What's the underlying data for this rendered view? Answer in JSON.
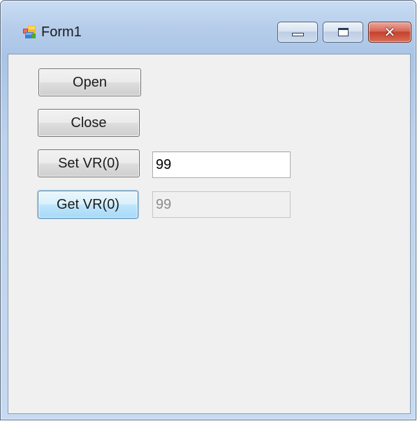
{
  "window": {
    "title": "Form1",
    "icon": "winforms-app-icon"
  },
  "titlebar_controls": {
    "minimize_icon": "minimize-icon",
    "maximize_icon": "maximize-icon",
    "close_symbol": "✕"
  },
  "buttons": {
    "open_label": "Open",
    "close_label": "Close",
    "set_label": "Set VR(0)",
    "get_label": "Get VR(0)"
  },
  "fields": {
    "set_value": "99",
    "get_value": "99"
  },
  "colors": {
    "focus_border": "#3c7fb1",
    "close_button_red": "#c5412f",
    "client_background": "#f0f0f0"
  }
}
